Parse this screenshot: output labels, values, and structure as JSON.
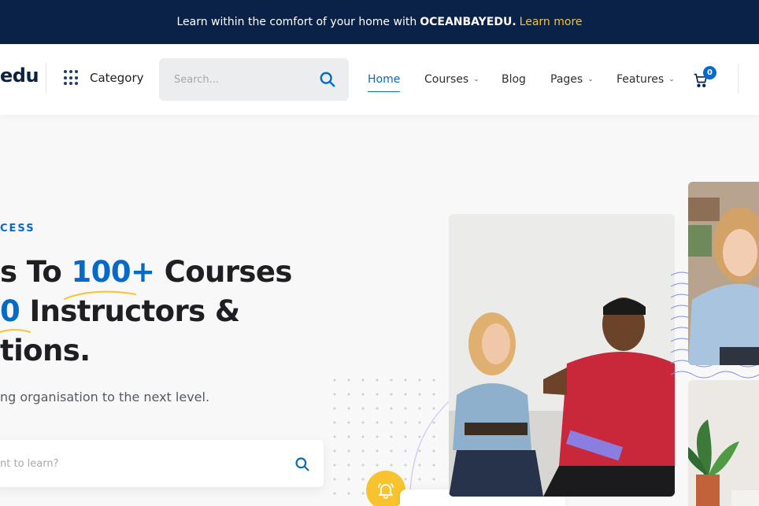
{
  "topbar": {
    "message": "Learn within the comfort of your home with",
    "brand": "OCEANBAYEDU.",
    "link": "Learn more"
  },
  "header": {
    "logo": "edu",
    "category_label": "Category",
    "search_placeholder": "Search...",
    "nav": [
      {
        "label": "Home",
        "active": true
      },
      {
        "label": "Courses",
        "has_dropdown": true
      },
      {
        "label": "Blog"
      },
      {
        "label": "Pages",
        "has_dropdown": true
      },
      {
        "label": "Features",
        "has_dropdown": true
      }
    ],
    "cart_count": "0"
  },
  "hero": {
    "eyebrow": "CESS",
    "line1_pre": "s To ",
    "line1_highlight": "100+",
    "line1_post": " Courses",
    "line2_highlight": "0",
    "line2_post": " Instructors &",
    "line3": "tions.",
    "subtitle": "ng organisation to the next level.",
    "search_placeholder": "nt to learn?"
  },
  "colors": {
    "navy": "#0a2148",
    "primary": "#066ac9",
    "accent": "#f7c32e"
  },
  "icons": [
    "grid-icon",
    "search-icon",
    "chevron-down-icon",
    "cart-icon",
    "bell-icon"
  ]
}
